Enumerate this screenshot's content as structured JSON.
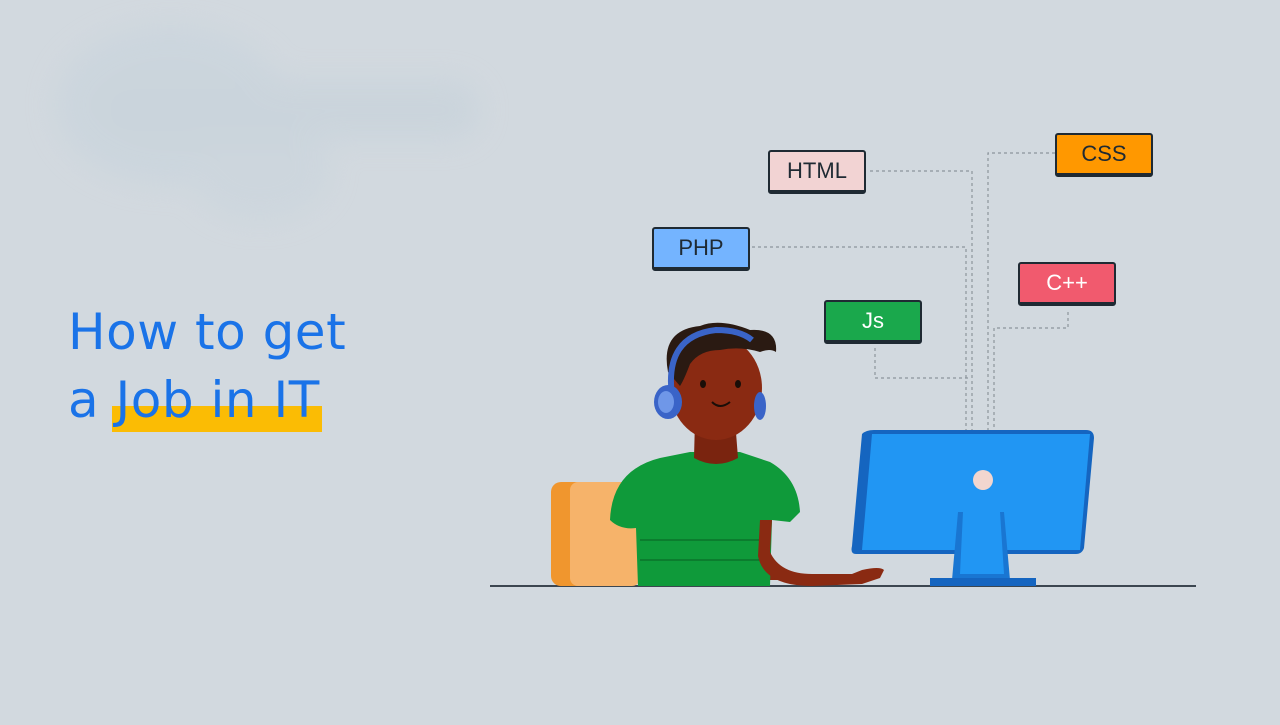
{
  "headline": {
    "line1": "How to get",
    "line2_prefix": "a",
    "line2_highlight": "Job in IT"
  },
  "tags": {
    "html": "HTML",
    "css": "CSS",
    "php": "PHP",
    "cpp": "C++",
    "js": "Js"
  },
  "colors": {
    "background": "#d2d9df",
    "headline": "#1a73e8",
    "highlight": "#fbbc04",
    "shirt": "#0f9a3a",
    "monitor": "#2196f3"
  }
}
